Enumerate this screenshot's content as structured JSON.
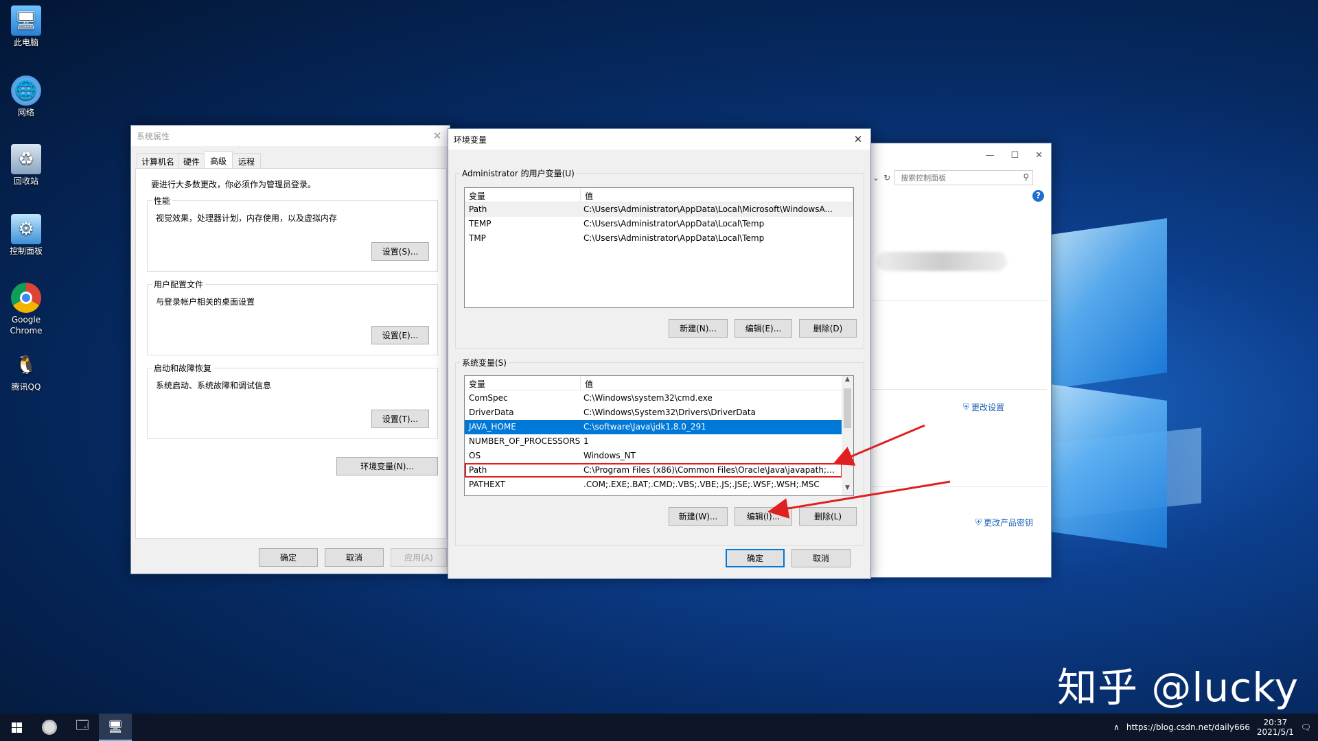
{
  "desktop": {
    "icons": [
      {
        "label": "此电脑",
        "icon": "this-pc-icon"
      },
      {
        "label": "网络",
        "icon": "network-icon"
      },
      {
        "label": "回收站",
        "icon": "recycle-bin-icon"
      },
      {
        "label": "控制面板",
        "icon": "control-panel-icon"
      },
      {
        "label": "Google Chrome",
        "icon": "chrome-icon"
      },
      {
        "label": "腾讯QQ",
        "icon": "qq-icon"
      }
    ],
    "watermark": "知乎 @lucky"
  },
  "system_properties": {
    "title": "系统属性",
    "tabs": [
      "计算机名",
      "硬件",
      "高级",
      "远程"
    ],
    "active_tab": "高级",
    "admin_note": "要进行大多数更改，你必须作为管理员登录。",
    "performance": {
      "label": "性能",
      "desc": "视觉效果，处理器计划，内存使用，以及虚拟内存",
      "button": "设置(S)..."
    },
    "user_profiles": {
      "label": "用户配置文件",
      "desc": "与登录帐户相关的桌面设置",
      "button": "设置(E)..."
    },
    "startup": {
      "label": "启动和故障恢复",
      "desc": "系统启动、系统故障和调试信息",
      "button": "设置(T)..."
    },
    "env_button": "环境变量(N)...",
    "ok": "确定",
    "cancel": "取消",
    "apply": "应用(A)"
  },
  "env_vars": {
    "title": "环境变量",
    "user_group": "Administrator 的用户变量(U)",
    "col_var": "变量",
    "col_val": "值",
    "user_rows": [
      {
        "name": "Path",
        "value": "C:\\Users\\Administrator\\AppData\\Local\\Microsoft\\WindowsA..."
      },
      {
        "name": "TEMP",
        "value": "C:\\Users\\Administrator\\AppData\\Local\\Temp"
      },
      {
        "name": "TMP",
        "value": "C:\\Users\\Administrator\\AppData\\Local\\Temp"
      }
    ],
    "user_buttons": {
      "new": "新建(N)...",
      "edit": "编辑(E)...",
      "delete": "删除(D)"
    },
    "system_group": "系统变量(S)",
    "system_rows": [
      {
        "name": "ComSpec",
        "value": "C:\\Windows\\system32\\cmd.exe"
      },
      {
        "name": "DriverData",
        "value": "C:\\Windows\\System32\\Drivers\\DriverData"
      },
      {
        "name": "JAVA_HOME",
        "value": "C:\\software\\Java\\jdk1.8.0_291"
      },
      {
        "name": "NUMBER_OF_PROCESSORS",
        "value": "1"
      },
      {
        "name": "OS",
        "value": "Windows_NT"
      },
      {
        "name": "Path",
        "value": "C:\\Program Files (x86)\\Common Files\\Oracle\\Java\\javapath;C..."
      },
      {
        "name": "PATHEXT",
        "value": ".COM;.EXE;.BAT;.CMD;.VBS;.VBE;.JS;.JSE;.WSF;.WSH;.MSC"
      }
    ],
    "system_buttons": {
      "new": "新建(W)...",
      "edit": "编辑(I)...",
      "delete": "删除(L)"
    },
    "ok": "确定",
    "cancel": "取消"
  },
  "control_panel": {
    "search_placeholder": "搜索控制面板",
    "change_settings": "更改设置",
    "change_product_key": "更改产品密钥"
  },
  "taskbar": {
    "tray_text": "https://blog.csdn.net/daily666",
    "time": "20:37",
    "date": "2021/5/1"
  },
  "colors": {
    "accent": "#0078d7",
    "highlight_red": "#e02020"
  }
}
